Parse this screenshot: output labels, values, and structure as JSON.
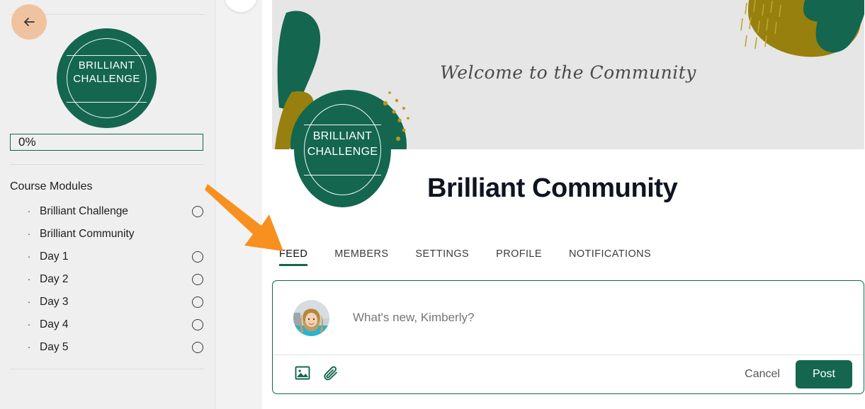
{
  "colors": {
    "brand_green": "#14664f",
    "brand_gold": "#97800d",
    "peach": "#f0c3a0",
    "sidebar_bg": "#efefef",
    "banner_bg": "#e6e6e6",
    "annotation_orange": "#f7901e",
    "page_title": "#0f1420"
  },
  "sidebar": {
    "back_icon": "arrow-left-icon",
    "badge": {
      "line1": "BRILLIANT",
      "line2": "CHALLENGE"
    },
    "progress": {
      "value_label": "0%",
      "percent": 0
    },
    "modules_heading": "Course Modules",
    "modules": [
      {
        "label": "Brilliant Challenge",
        "bullet": "·",
        "has_checkbox": true,
        "checked": false
      },
      {
        "label": "Brilliant Community",
        "bullet": "·",
        "has_checkbox": false,
        "checked": false
      },
      {
        "label": "Day 1",
        "bullet": "·",
        "has_checkbox": true,
        "checked": false
      },
      {
        "label": "Day 2",
        "bullet": "·",
        "has_checkbox": true,
        "checked": false
      },
      {
        "label": "Day 3",
        "bullet": "·",
        "has_checkbox": true,
        "checked": false
      },
      {
        "label": "Day 4",
        "bullet": "·",
        "has_checkbox": true,
        "checked": false
      },
      {
        "label": "Day 5",
        "bullet": "·",
        "has_checkbox": true,
        "checked": false
      }
    ]
  },
  "banner": {
    "welcome_text": "Welcome to the Community"
  },
  "logo": {
    "line1": "BRILLIANT",
    "line2": "CHALLENGE"
  },
  "main": {
    "page_title": "Brilliant Community",
    "tabs": [
      {
        "label": "FEED",
        "active": true
      },
      {
        "label": "MEMBERS",
        "active": false
      },
      {
        "label": "SETTINGS",
        "active": false
      },
      {
        "label": "PROFILE",
        "active": false
      },
      {
        "label": "NOTIFICATIONS",
        "active": false
      }
    ]
  },
  "composer": {
    "avatar_name": "user-avatar",
    "placeholder": "What's new, Kimberly?",
    "value": "",
    "image_icon": "image-icon",
    "attachment_icon": "paperclip-icon",
    "cancel_label": "Cancel",
    "post_label": "Post"
  },
  "annotation": {
    "type": "arrow",
    "color": "#f7901e",
    "points_to": "FEED tab",
    "from": [
      293,
      262
    ],
    "to": [
      396,
      352
    ]
  }
}
